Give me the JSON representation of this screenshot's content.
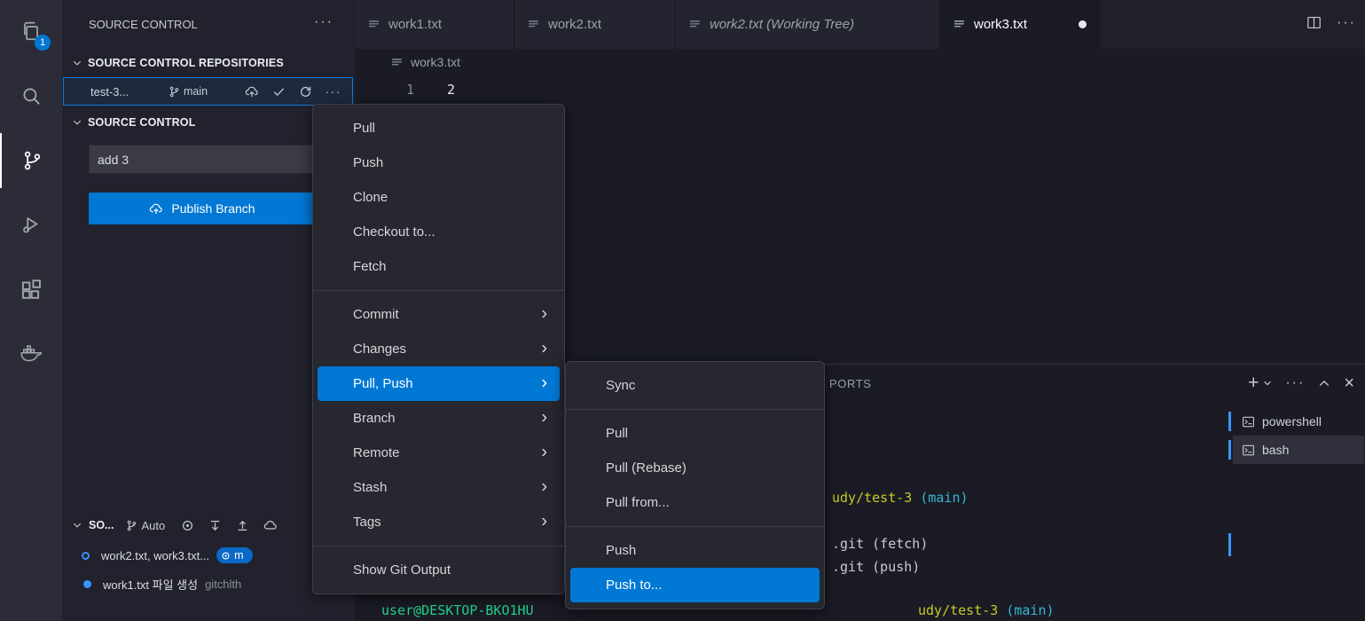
{
  "activity_bar": {
    "badge": "1",
    "items": [
      {
        "name": "explorer",
        "icon": "files-icon"
      },
      {
        "name": "search",
        "icon": "search-icon"
      },
      {
        "name": "source-control",
        "icon": "source-control-icon",
        "active": true
      },
      {
        "name": "run-debug",
        "icon": "run-debug-icon"
      },
      {
        "name": "extensions",
        "icon": "extensions-icon"
      },
      {
        "name": "docker",
        "icon": "docker-icon"
      }
    ]
  },
  "sidebar": {
    "title": "SOURCE CONTROL",
    "repositories_section": {
      "label": "SOURCE CONTROL REPOSITORIES",
      "repo": {
        "name": "test-3...",
        "branch": "main"
      }
    },
    "source_control_section": {
      "label": "SOURCE CONTROL",
      "commit_input": "add 3",
      "publish_button": "Publish Branch"
    },
    "graph_section": {
      "label": "SO...",
      "branch_filter": "Auto",
      "rows": [
        {
          "message": "work2.txt, work3.txt...",
          "ref": "m"
        },
        {
          "message": "work1.txt 파일 생성",
          "author": "gitchlth"
        }
      ]
    }
  },
  "tabs": {
    "items": [
      {
        "label": "work1.txt"
      },
      {
        "label": "work2.txt"
      },
      {
        "label": "work2.txt (Working Tree)"
      },
      {
        "label": "work3.txt",
        "modified": true
      }
    ]
  },
  "editor": {
    "breadcrumb": "work3.txt",
    "line_number": "1",
    "line_text": "2"
  },
  "menu": {
    "items": [
      {
        "label": "Pull"
      },
      {
        "label": "Push"
      },
      {
        "label": "Clone"
      },
      {
        "label": "Checkout to..."
      },
      {
        "label": "Fetch"
      },
      {
        "label": "Commit"
      },
      {
        "label": "Changes"
      },
      {
        "label": "Pull, Push"
      },
      {
        "label": "Branch"
      },
      {
        "label": "Remote"
      },
      {
        "label": "Stash"
      },
      {
        "label": "Tags"
      },
      {
        "label": "Show Git Output"
      }
    ]
  },
  "submenu": {
    "items": [
      {
        "label": "Sync"
      },
      {
        "label": "Pull"
      },
      {
        "label": "Pull (Rebase)"
      },
      {
        "label": "Pull from..."
      },
      {
        "label": "Push"
      },
      {
        "label": "Push to..."
      }
    ]
  },
  "panel": {
    "visible_tab": "PORTS",
    "terminals": [
      {
        "label": "powershell"
      },
      {
        "label": "bash",
        "active": true
      }
    ]
  },
  "terminal": {
    "prompt_user": "user@DESKTOP-BKO1HU",
    "prompt_path_tail": "udy/test-3 ",
    "prompt_branch": "(main)",
    "fetch_line": ".git (fetch)",
    "push_line": ".git (push)"
  },
  "colors": {
    "accent": "#0078d4",
    "badge": "#0078d4",
    "graph_node": "#3794ff",
    "terminal_green": "#23d18b",
    "terminal_yellow": "#c9c926",
    "terminal_cyan": "#35b8d8"
  }
}
